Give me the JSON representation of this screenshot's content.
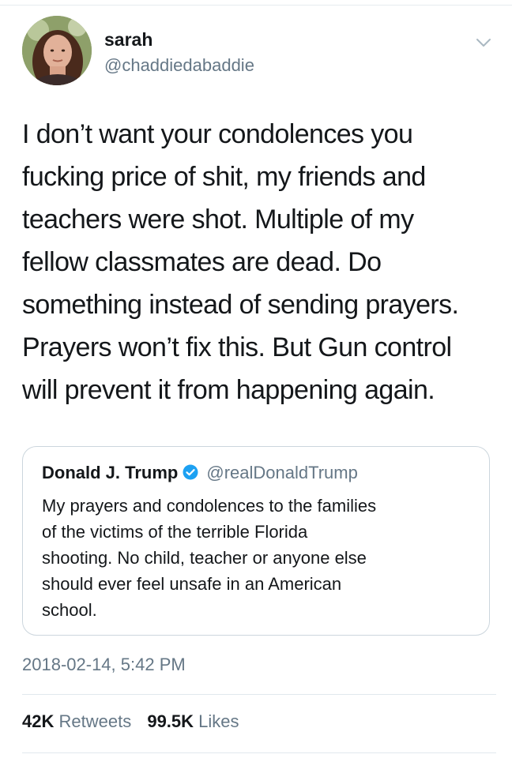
{
  "author": {
    "name": "sarah",
    "handle": "@chaddiedabaddie"
  },
  "tweet": {
    "lines": [
      "I don’t want your condolences you",
      "fucking price of shit, my friends and",
      "teachers were shot. Multiple of my",
      "fellow classmates are dead. Do",
      "something instead of sending prayers.",
      "Prayers won’t fix this. But Gun control",
      "will prevent it from happening again."
    ]
  },
  "quoted_tweet": {
    "name": "Donald J. Trump",
    "handle": "@realDonaldTrump",
    "verified": true,
    "lines": [
      "My prayers and condolences to the families",
      "of the victims of the terrible Florida",
      "shooting. No child, teacher or anyone else",
      "should ever feel unsafe in an American",
      "school."
    ]
  },
  "timestamp": "2018-02-14, 5:42 PM",
  "stats": {
    "retweets_count": "42K",
    "retweets_label": "Retweets",
    "likes_count": "99.5K",
    "likes_label": "Likes"
  },
  "colors": {
    "text": "#14171a",
    "secondary": "#657786",
    "verified_blue": "#1da1f2",
    "border": "#ccd6dd"
  },
  "icons": {
    "menu": "chevron-down-icon",
    "verified": "verified-badge-icon"
  }
}
